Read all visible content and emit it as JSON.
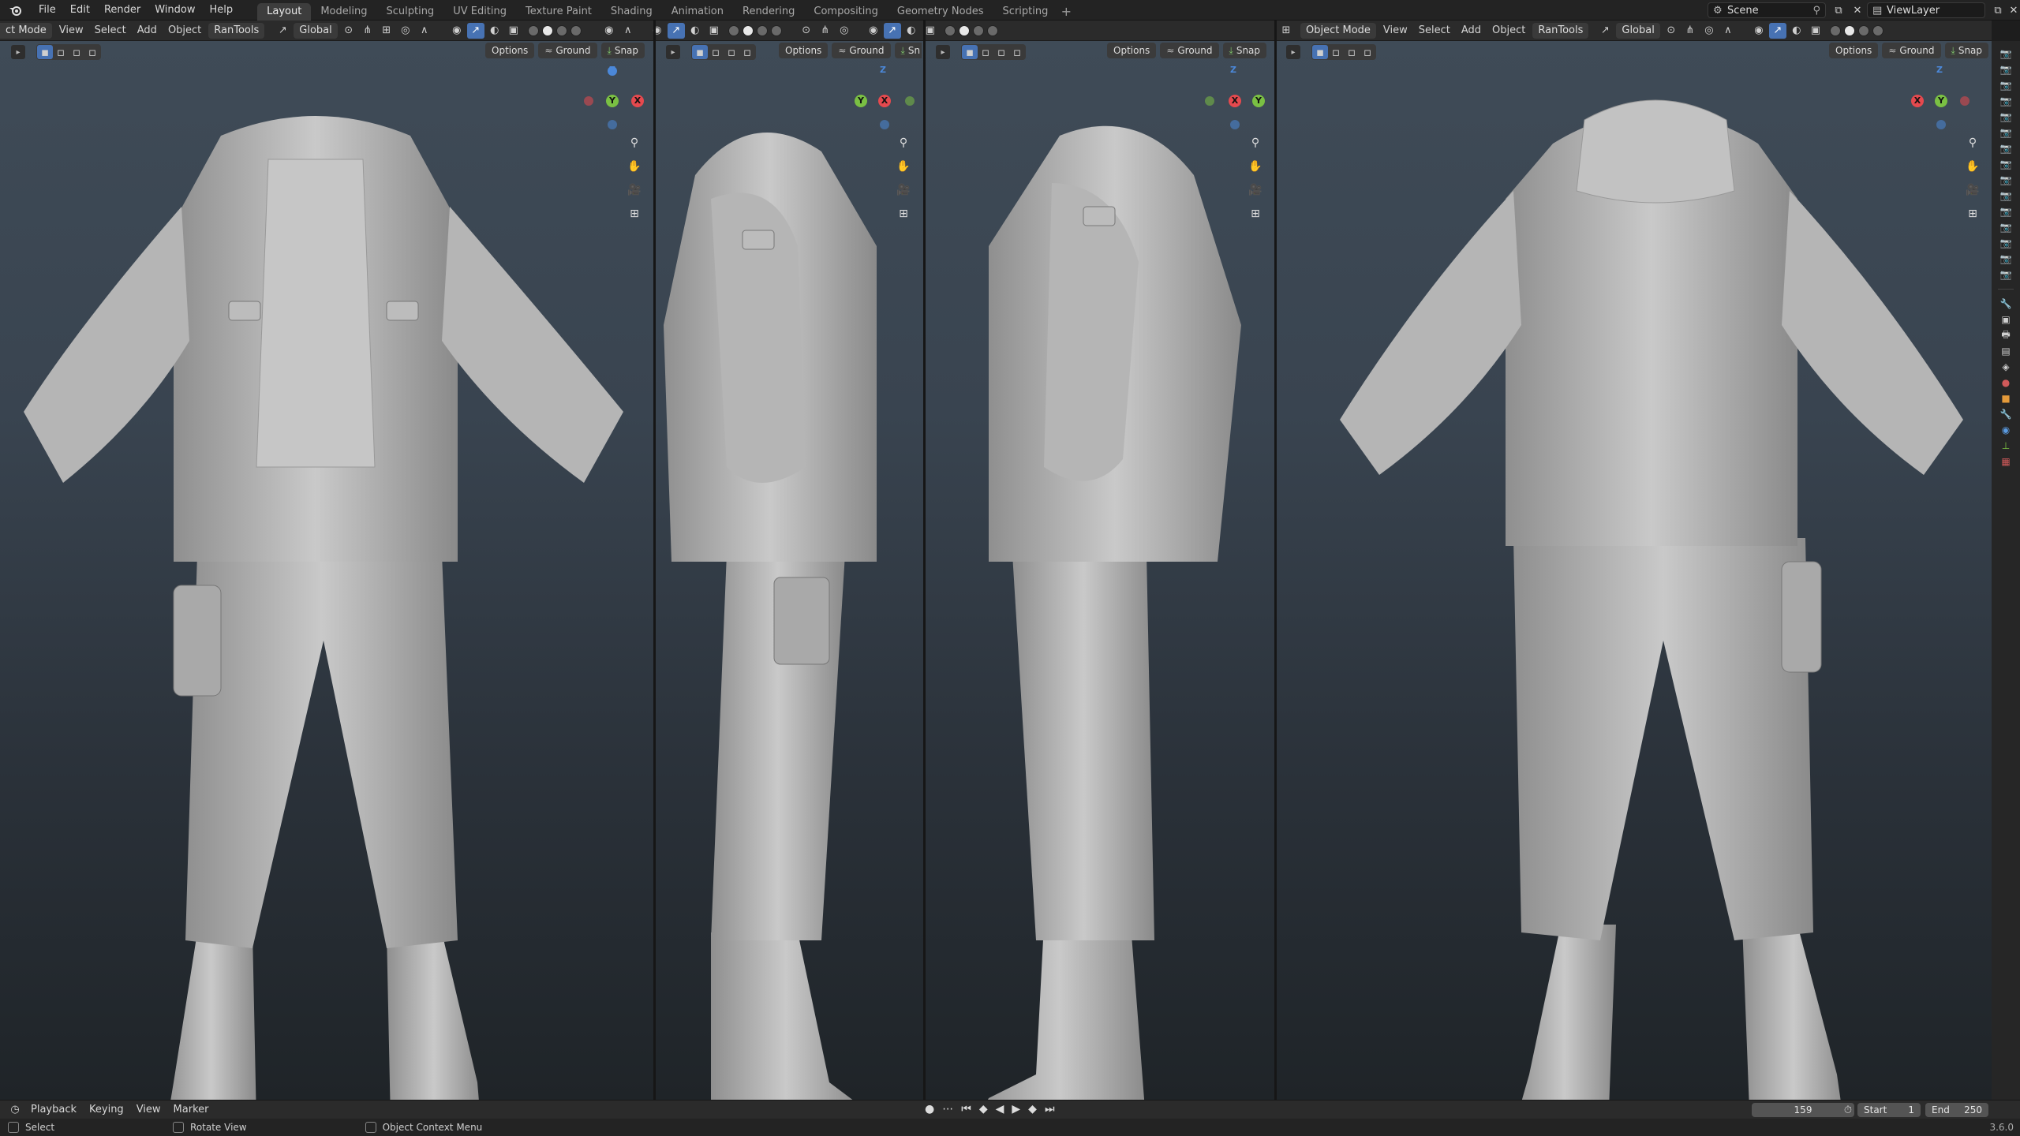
{
  "top_menu": {
    "items": [
      "File",
      "Edit",
      "Render",
      "Window",
      "Help"
    ],
    "workspaces": [
      "Layout",
      "Modeling",
      "Sculpting",
      "UV Editing",
      "Texture Paint",
      "Shading",
      "Animation",
      "Rendering",
      "Compositing",
      "Geometry Nodes",
      "Scripting"
    ],
    "active_workspace": "Layout",
    "add_tab": "+",
    "scene_name": "Scene",
    "view_layer": "ViewLayer"
  },
  "viewport_headers": {
    "left": {
      "mode": "ct Mode",
      "menus": [
        "View",
        "Select",
        "Add",
        "Object"
      ],
      "addon": "RanTools",
      "transform": "Global"
    },
    "right": {
      "mode": "Object Mode",
      "menus": [
        "View",
        "Select",
        "Add",
        "Object"
      ],
      "addon": "RanTools",
      "transform": "Global"
    }
  },
  "viewport_tools": {
    "options": "Options",
    "ground": "Ground",
    "snap": "Snap",
    "snap_clipped": "Sn"
  },
  "gizmo_labels": {
    "z": "Z",
    "y": "Y",
    "x": "X"
  },
  "timeline": {
    "playback": "Playback",
    "keying": "Keying",
    "view": "View",
    "marker": "Marker",
    "current_frame": "159",
    "start_label": "Start",
    "start": "1",
    "end_label": "End",
    "end": "250"
  },
  "status_bar": {
    "select": "Select",
    "rotate_view": "Rotate View",
    "context_menu": "Object Context Menu",
    "version": "3.6.0"
  },
  "colors": {
    "active_blue": "#4772b3",
    "axis_x": "#e5494e",
    "axis_y": "#7ac043",
    "axis_z": "#4b88d9",
    "model_gray": "#b8b8b8"
  }
}
